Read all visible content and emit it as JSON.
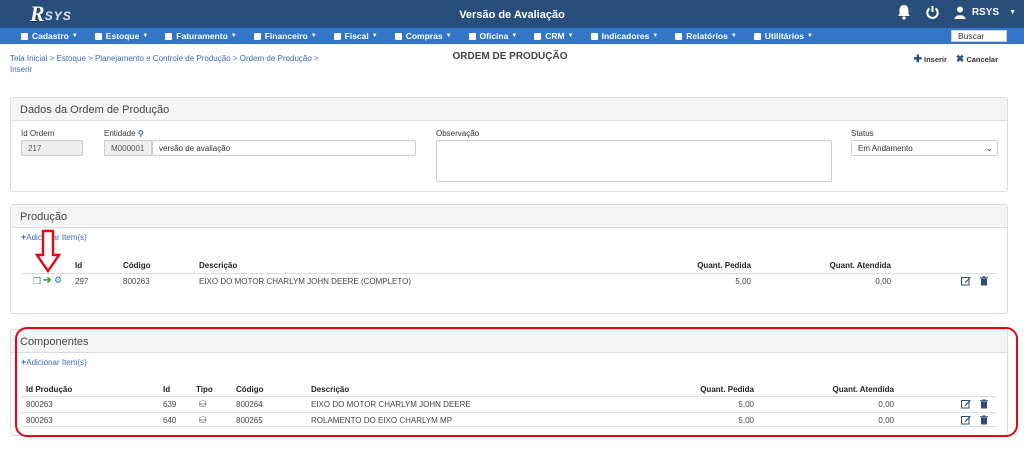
{
  "topbar": {
    "logo_letter": "R",
    "logo_text": "SYS",
    "title": "Versão de Avaliação",
    "user": "RSYS"
  },
  "menu": [
    {
      "label": "Cadastro"
    },
    {
      "label": "Estoque"
    },
    {
      "label": "Faturamento"
    },
    {
      "label": "Financeiro"
    },
    {
      "label": "Fiscal"
    },
    {
      "label": "Compras"
    },
    {
      "label": "Oficina"
    },
    {
      "label": "CRM"
    },
    {
      "label": "Indicadores"
    },
    {
      "label": "Relatórios"
    },
    {
      "label": "Utilitários"
    }
  ],
  "search_label": "Buscar",
  "breadcrumb": {
    "l1": "Tela Inicial",
    "l2": "Estoque",
    "l3": "Planejamento e Controle de Produção",
    "l4": "Ordem de Produção",
    "l5": "Inserir",
    "sep": " > "
  },
  "page_title": "ORDEM DE PRODUÇÃO",
  "actions": {
    "insert": "Inserir",
    "cancel": "Cancelar"
  },
  "dados": {
    "title": "Dados da Ordem de Produção",
    "id_label": "Id Ordem",
    "id_value": "217",
    "entidade_label": "Entidade",
    "entidade_code": "M000001",
    "entidade_name": "versão de avaliação",
    "obs_label": "Observação",
    "obs_value": "",
    "status_label": "Status",
    "status_value": "Em Andamento"
  },
  "producao": {
    "title": "Produção",
    "add_label": "Adicionar Item(s)",
    "headers": {
      "id": "Id",
      "codigo": "Código",
      "descricao": "Descrição",
      "qp": "Quant. Pedida",
      "qa": "Quant. Atendida"
    },
    "rows": [
      {
        "id": "297",
        "codigo": "800263",
        "descricao": "EIXO DO MOTOR CHARLYM JOHN DEERE (COMPLETO)",
        "qp": "5,00",
        "qa": "0,00"
      }
    ]
  },
  "componentes": {
    "title": "Componentes",
    "add_label": "Adicionar Item(s)",
    "headers": {
      "idprod": "Id Produção",
      "id": "Id",
      "tipo": "Tipo",
      "codigo": "Código",
      "descricao": "Descrição",
      "qp": "Quant. Pedida",
      "qa": "Quant. Atendida"
    },
    "rows": [
      {
        "idprod": "800263",
        "id": "639",
        "codigo": "800264",
        "descricao": "EIXO DO MOTOR CHARLYM JOHN DEERE",
        "qp": "5,00",
        "qa": "0,00"
      },
      {
        "idprod": "800263",
        "id": "640",
        "codigo": "800265",
        "descricao": "ROLAMENTO DO EIXO CHARLYM MP",
        "qp": "5,00",
        "qa": "0,00"
      }
    ]
  },
  "colors": {
    "topbar": "#2a4e7c",
    "menubar": "#3376c8",
    "link": "#3a6db0",
    "annotation": "#e30613"
  }
}
